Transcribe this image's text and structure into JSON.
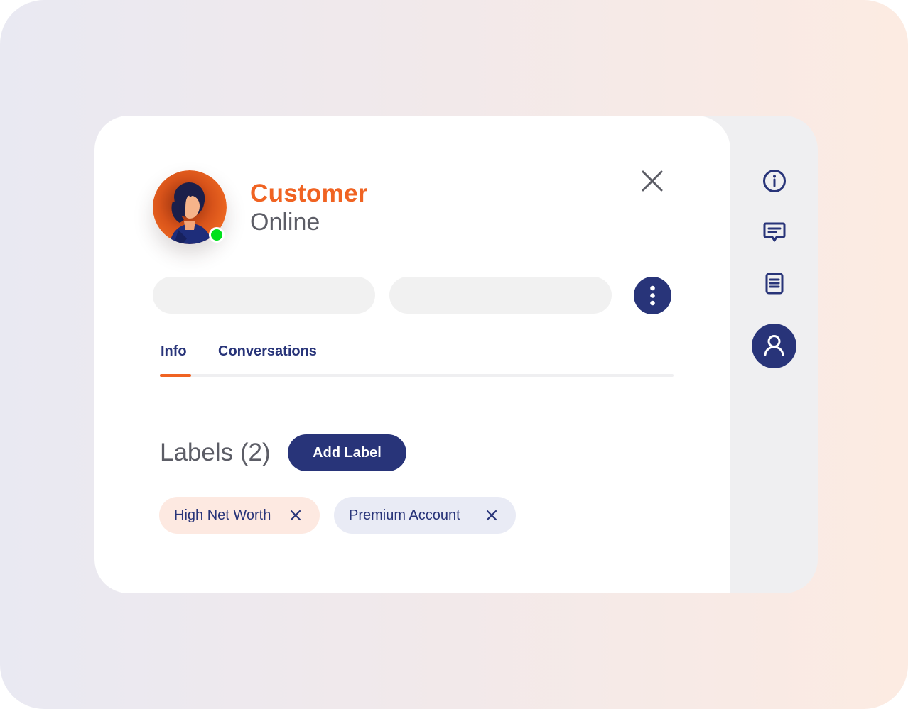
{
  "contact": {
    "name": "Customer",
    "status": "Online"
  },
  "tabs": [
    {
      "label": "Info",
      "active": true
    },
    {
      "label": "Conversations",
      "active": false
    }
  ],
  "labels": {
    "heading": "Labels (2)",
    "add_button": "Add Label",
    "items": [
      {
        "text": "High Net Worth",
        "color": "#fde9e1"
      },
      {
        "text": "Premium Account",
        "color": "#e9ebf5"
      }
    ]
  },
  "sidebar": {
    "items": [
      {
        "icon": "info-icon",
        "active": false
      },
      {
        "icon": "chat-icon",
        "active": false
      },
      {
        "icon": "notes-icon",
        "active": false
      },
      {
        "icon": "user-icon",
        "active": true
      }
    ]
  },
  "colors": {
    "accent": "#f06322",
    "primary": "#283479",
    "online": "#00e11d"
  }
}
